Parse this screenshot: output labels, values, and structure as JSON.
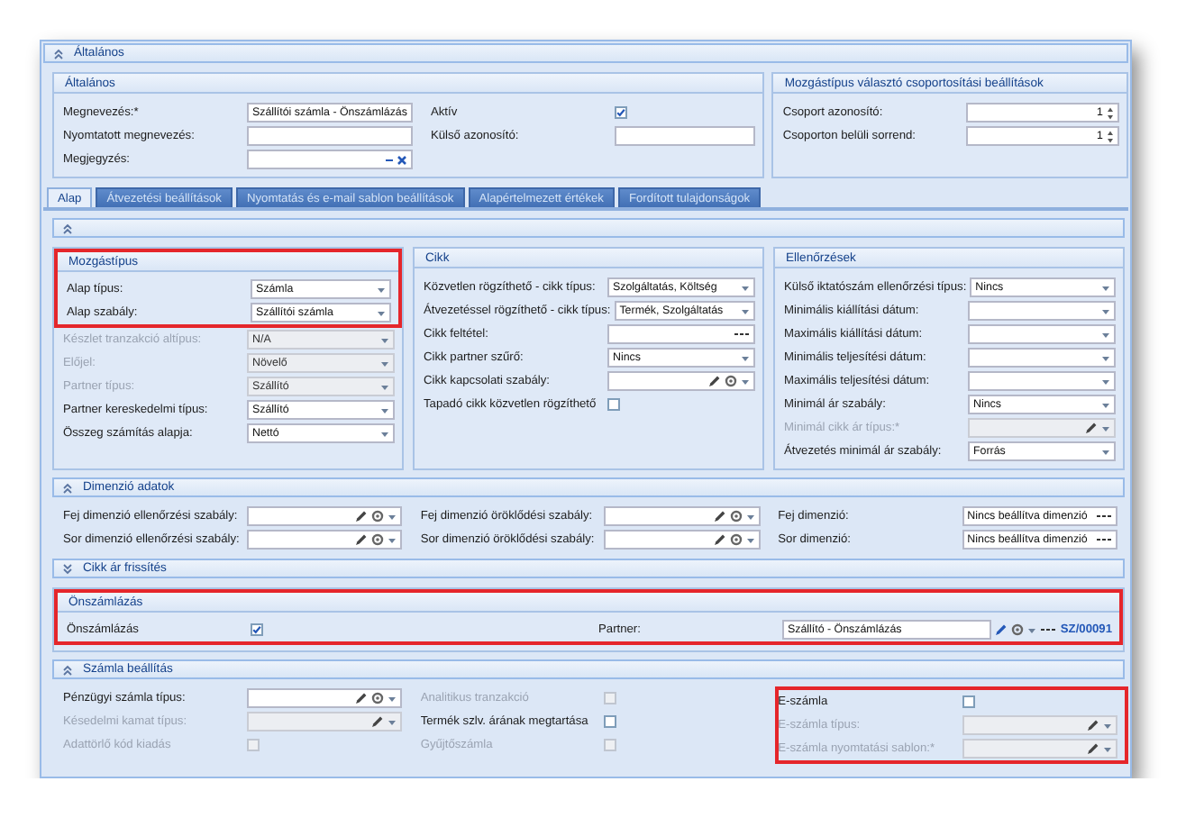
{
  "title_bar": {
    "title": "Általános",
    "expanded": true
  },
  "general_groups": [
    {
      "title": "Általános",
      "highlighted": false,
      "columns": [
        {
          "fields": [
            {
              "kind": "text",
              "label": "Megnevezés:*",
              "value": "Szállítói számla - Önszámlázás",
              "disabled": false,
              "highlighted": false
            },
            {
              "kind": "text",
              "label": "Nyomtatott megnevezés:",
              "disabled": false,
              "highlighted": false
            },
            {
              "kind": "memo",
              "label": "Megjegyzés:",
              "disabled": false,
              "highlighted": false
            }
          ]
        },
        {
          "fields": [
            {
              "kind": "check",
              "label": "Aktív",
              "checked": true,
              "disabled": false,
              "highlighted": false
            },
            {
              "kind": "text",
              "label": "Külső azonosító:",
              "disabled": false,
              "highlighted": false
            }
          ]
        }
      ]
    },
    {
      "title": "Mozgástípus választó csoportosítási beállítások",
      "highlighted": false,
      "columns": [
        {
          "fields": [
            {
              "kind": "spin",
              "label": "Csoport azonosító:",
              "value": "1",
              "disabled": false,
              "highlighted": false
            },
            {
              "kind": "spin",
              "label": "Csoporton belüli sorrend:",
              "value": "1",
              "disabled": false,
              "highlighted": false
            }
          ]
        }
      ]
    }
  ],
  "tabs": [
    {
      "label": "Alap",
      "selected": true
    },
    {
      "label": "Átvezetési beállítások",
      "selected": false
    },
    {
      "label": "Nyomtatás és e-mail sablon beállítások",
      "selected": false
    },
    {
      "label": "Alapértelmezett értékek",
      "selected": false
    },
    {
      "label": "Fordított tulajdonságok",
      "selected": false
    }
  ],
  "sections": [
    {
      "expanded": true,
      "groups": [
        {
          "title": "Mozgástípus",
          "highlighted": true,
          "columns": [
            {
              "fields": [
                {
                  "kind": "combo",
                  "label": "Alap típus:",
                  "value": "Számla",
                  "disabled": false,
                  "highlighted": true
                },
                {
                  "kind": "combo",
                  "label": "Alap szabály:",
                  "value": "Szállítói számla",
                  "disabled": false,
                  "highlighted": true
                },
                {
                  "kind": "combo",
                  "label": "Készlet tranzakció altípus:",
                  "value": "N/A",
                  "disabled": true,
                  "highlighted": false
                },
                {
                  "kind": "combo",
                  "label": "Előjel:",
                  "value": "Növelő",
                  "disabled": true,
                  "highlighted": false
                },
                {
                  "kind": "combo",
                  "label": "Partner típus:",
                  "value": "Szállító",
                  "disabled": true,
                  "highlighted": false
                },
                {
                  "kind": "combo",
                  "label": "Partner kereskedelmi típus:",
                  "value": "Szállító",
                  "disabled": false,
                  "highlighted": false
                },
                {
                  "kind": "combo",
                  "label": "Összeg számítás alapja:",
                  "value": "Nettó",
                  "disabled": false,
                  "highlighted": false
                }
              ]
            }
          ]
        },
        {
          "title": "Cikk",
          "highlighted": false,
          "columns": [
            {
              "fields": [
                {
                  "kind": "combo",
                  "label": "Közvetlen rögzíthető - cikk típus:",
                  "value": "Szolgáltatás, Költség",
                  "disabled": false,
                  "highlighted": false
                },
                {
                  "kind": "combo",
                  "label": "Átvezetéssel rögzíthető - cikk típus:",
                  "value": "Termék, Szolgáltatás",
                  "disabled": false,
                  "highlighted": false
                },
                {
                  "kind": "ellipsis",
                  "label": "Cikk feltétel:",
                  "disabled": false,
                  "highlighted": false
                },
                {
                  "kind": "combo",
                  "label": "Cikk partner szűrő:",
                  "value": "Nincs",
                  "disabled": false,
                  "highlighted": false
                },
                {
                  "kind": "lookup",
                  "label": "Cikk kapcsolati szabály:",
                  "disabled": false,
                  "highlighted": false
                },
                {
                  "kind": "check",
                  "label": "Tapadó cikk közvetlen rögzíthető",
                  "checked": false,
                  "disabled": false,
                  "highlighted": false
                }
              ]
            }
          ]
        },
        {
          "title": "Ellenőrzések",
          "highlighted": false,
          "columns": [
            {
              "fields": [
                {
                  "kind": "combo",
                  "label": "Külső iktatószám ellenőrzési típus:",
                  "value": "Nincs",
                  "disabled": false,
                  "highlighted": false
                },
                {
                  "kind": "combo",
                  "label": "Minimális kiállítási dátum:",
                  "disabled": false,
                  "highlighted": false
                },
                {
                  "kind": "combo",
                  "label": "Maximális kiállítási dátum:",
                  "disabled": false,
                  "highlighted": false
                },
                {
                  "kind": "combo",
                  "label": "Minimális teljesítési dátum:",
                  "disabled": false,
                  "highlighted": false
                },
                {
                  "kind": "combo",
                  "label": "Maximális teljesítési dátum:",
                  "disabled": false,
                  "highlighted": false
                },
                {
                  "kind": "combo",
                  "label": "Minimál ár szabály:",
                  "value": "Nincs",
                  "disabled": false,
                  "highlighted": false
                },
                {
                  "kind": "lookup",
                  "label": "Minimál cikk ár típus:*",
                  "disabled": true,
                  "highlighted": false
                },
                {
                  "kind": "combo",
                  "label": "Átvezetés minimál ár szabály:",
                  "value": "Forrás",
                  "disabled": false,
                  "highlighted": false
                }
              ]
            }
          ]
        }
      ]
    },
    {
      "title": "Dimenzió adatok",
      "expanded": true,
      "columns": [
        {
          "fields": [
            {
              "kind": "lookup",
              "label": "Fej dimenzió ellenőrzési szabály:",
              "disabled": false,
              "highlighted": false
            },
            {
              "kind": "lookup",
              "label": "Sor dimenzió ellenőrzési szabály:",
              "disabled": false,
              "highlighted": false
            }
          ]
        },
        {
          "fields": [
            {
              "kind": "lookup",
              "label": "Fej dimenzió öröklődési szabály:",
              "disabled": false,
              "highlighted": false
            },
            {
              "kind": "lookup",
              "label": "Sor dimenzió öröklődési szabály:",
              "disabled": false,
              "highlighted": false
            }
          ]
        },
        {
          "fields": [
            {
              "kind": "ellipsis",
              "label": "Fej dimenzió:",
              "value": "Nincs beállítva dimenzió",
              "disabled": false,
              "highlighted": false
            },
            {
              "kind": "ellipsis",
              "label": "Sor dimenzió:",
              "value": "Nincs beállítva dimenzió",
              "disabled": false,
              "highlighted": false
            }
          ]
        }
      ]
    },
    {
      "title": "Cikk ár frissítés",
      "expanded": false
    },
    {
      "groups": [
        {
          "title": "Önszámlázás",
          "highlighted": true,
          "columns": [
            {
              "fields": [
                {
                  "kind": "check",
                  "label": "Önszámlázás",
                  "checked": true,
                  "disabled": false,
                  "highlighted": true
                }
              ]
            },
            {
              "fields": [
                {
                  "kind": "partner",
                  "label": "Partner:",
                  "value": "Szállító - Önszámlázás",
                  "code": "SZ/00091",
                  "disabled": false,
                  "highlighted": true
                }
              ]
            }
          ]
        }
      ]
    },
    {
      "title": "Számla beállítás",
      "expanded": true,
      "columns": [
        {
          "fields": [
            {
              "kind": "lookup",
              "label": "Pénzügyi számla típus:",
              "disabled": false,
              "highlighted": false
            },
            {
              "kind": "lookup",
              "label": "Késedelmi kamat típus:",
              "disabled": true,
              "highlighted": false
            },
            {
              "kind": "check",
              "label": "Adattörlő kód kiadás",
              "checked": false,
              "disabled": true,
              "highlighted": false
            }
          ]
        },
        {
          "fields": [
            {
              "kind": "check",
              "label": "Analitikus tranzakció",
              "checked": false,
              "disabled": true,
              "highlighted": false
            },
            {
              "kind": "check",
              "label": "Termék szlv. árának megtartása",
              "checked": false,
              "disabled": false,
              "highlighted": false
            },
            {
              "kind": "check",
              "label": "Gyűjtőszámla",
              "checked": false,
              "disabled": true,
              "highlighted": false
            }
          ]
        },
        {
          "fields": [
            {
              "kind": "check",
              "label": "E-számla",
              "checked": false,
              "disabled": false,
              "highlighted": true
            },
            {
              "kind": "lookup",
              "label": "E-számla típus:",
              "disabled": true,
              "highlighted": true
            },
            {
              "kind": "lookup",
              "label": "E-számla nyomtatási sablon:*",
              "disabled": true,
              "highlighted": true
            }
          ]
        }
      ]
    }
  ]
}
